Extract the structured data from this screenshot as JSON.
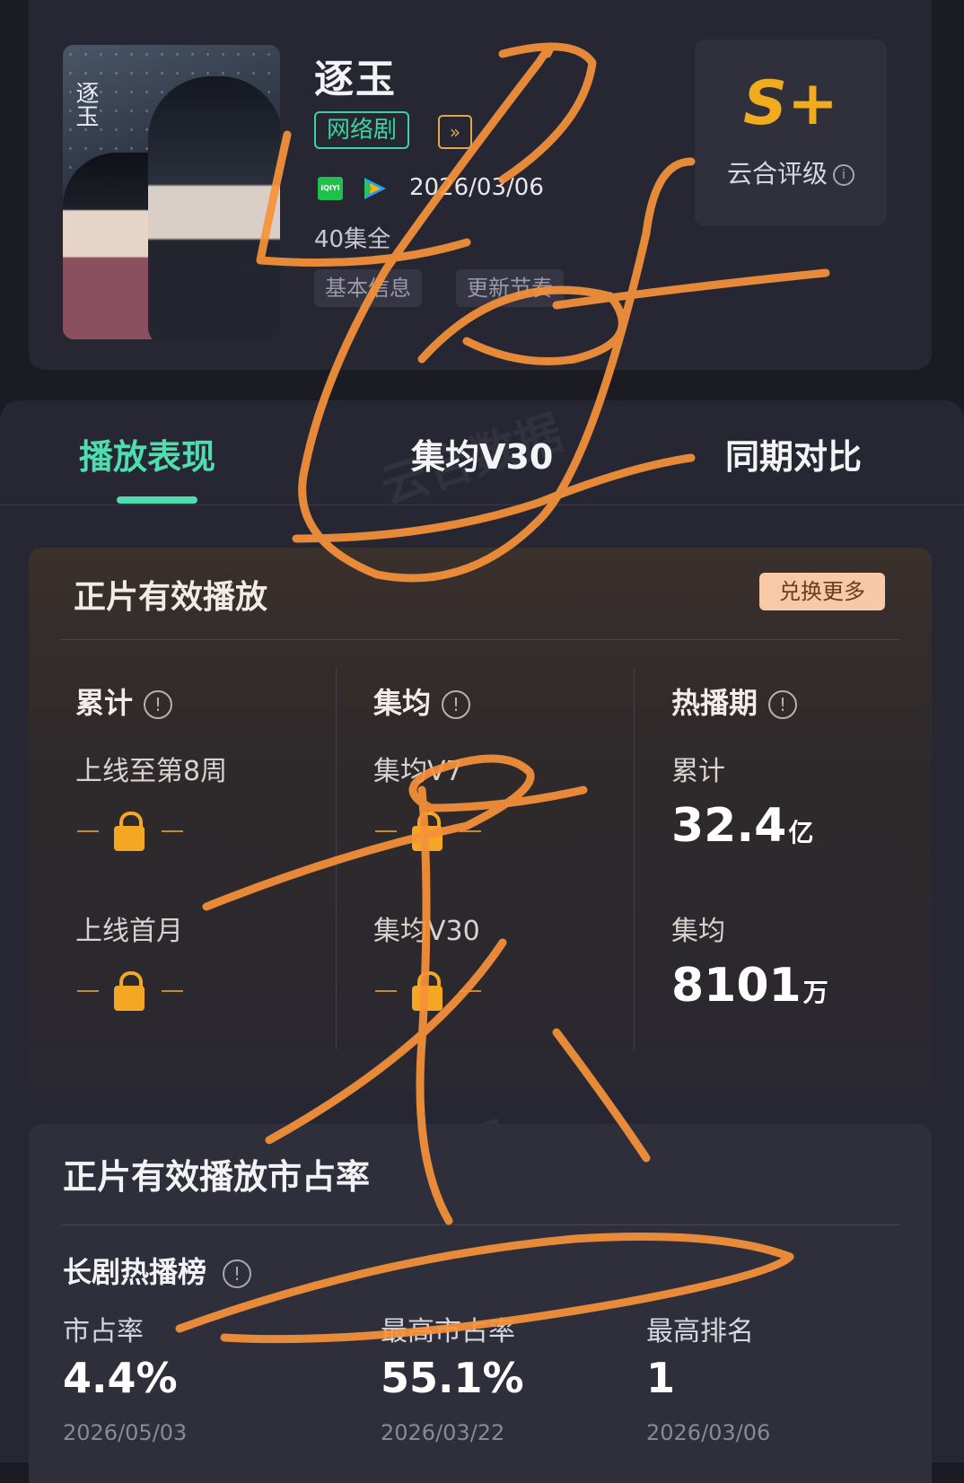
{
  "show": {
    "poster_title": "逐玉",
    "title": "逐玉",
    "type_badge": "网络剧",
    "play_icon": "double-chevron-icon",
    "platform_iqiyi": "iQIYI",
    "release_date": "2026/03/06",
    "episodes": "40集全",
    "chips": [
      "基本信息",
      "更新节奏"
    ],
    "rating": "S+",
    "rating_label": "云合评级",
    "info_mark": "i"
  },
  "tabs": [
    "播放表现",
    "集均V30",
    "同期对比"
  ],
  "playback": {
    "title": "正片有效播放",
    "exchange_button": "兑换更多",
    "info_mark": "!",
    "columns": [
      {
        "heading": "累计",
        "items": [
          {
            "label": "上线至第8周",
            "locked": true
          },
          {
            "label": "上线首月",
            "locked": true
          }
        ]
      },
      {
        "heading": "集均",
        "items": [
          {
            "label": "集均V7",
            "locked": true
          },
          {
            "label": "集均V30",
            "locked": true
          }
        ]
      },
      {
        "heading": "热播期",
        "items": [
          {
            "label": "累计",
            "value": "32.4",
            "unit": "亿"
          },
          {
            "label": "集均",
            "value": "8101",
            "unit": "万"
          }
        ]
      }
    ]
  },
  "market_share": {
    "title": "正片有效播放市占率",
    "ranking_title": "长剧热播榜",
    "info_mark": "!",
    "stats": [
      {
        "label": "市占率",
        "value": "4.4%",
        "date": "2026/05/03"
      },
      {
        "label": "最高市占率",
        "value": "55.1%",
        "date": "2026/03/22"
      },
      {
        "label": "最高排名",
        "value": "1",
        "date": "2026/03/06"
      }
    ]
  },
  "watermark": {
    "brand": "云合数据",
    "brand_en": "ENLIGHTENT"
  },
  "colors": {
    "accent": "#4fdcae",
    "rating": "#f0ac1e",
    "lock": "#f4a722",
    "scribble": "#f7923a"
  }
}
